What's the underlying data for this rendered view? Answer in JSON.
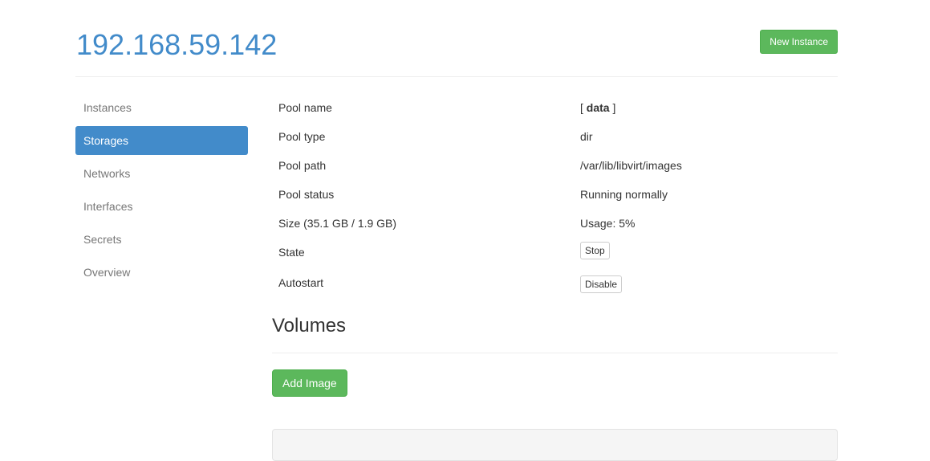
{
  "header": {
    "host": "192.168.59.142",
    "new_instance_label": "New Instance"
  },
  "sidebar": {
    "items": [
      {
        "label": "Instances"
      },
      {
        "label": "Storages"
      },
      {
        "label": "Networks"
      },
      {
        "label": "Interfaces"
      },
      {
        "label": "Secrets"
      },
      {
        "label": "Overview"
      }
    ],
    "active": "Storages"
  },
  "pool": {
    "name_label": "Pool name",
    "name_open": "[ ",
    "name_value": "data",
    "name_close": " ]",
    "type_label": "Pool type",
    "type_value": "dir",
    "path_label": "Pool path",
    "path_value": "/var/lib/libvirt/images",
    "status_label": "Pool status",
    "status_value": "Running normally",
    "size_label": "Size (35.1 GB / 1.9 GB)",
    "usage_value": "Usage: 5%",
    "state_label": "State",
    "state_button": "Stop",
    "autostart_label": "Autostart",
    "autostart_button": "Disable"
  },
  "volumes": {
    "title": "Volumes",
    "add_image_label": "Add Image"
  },
  "colors": {
    "primary": "#428bca",
    "success": "#5cb85c"
  }
}
